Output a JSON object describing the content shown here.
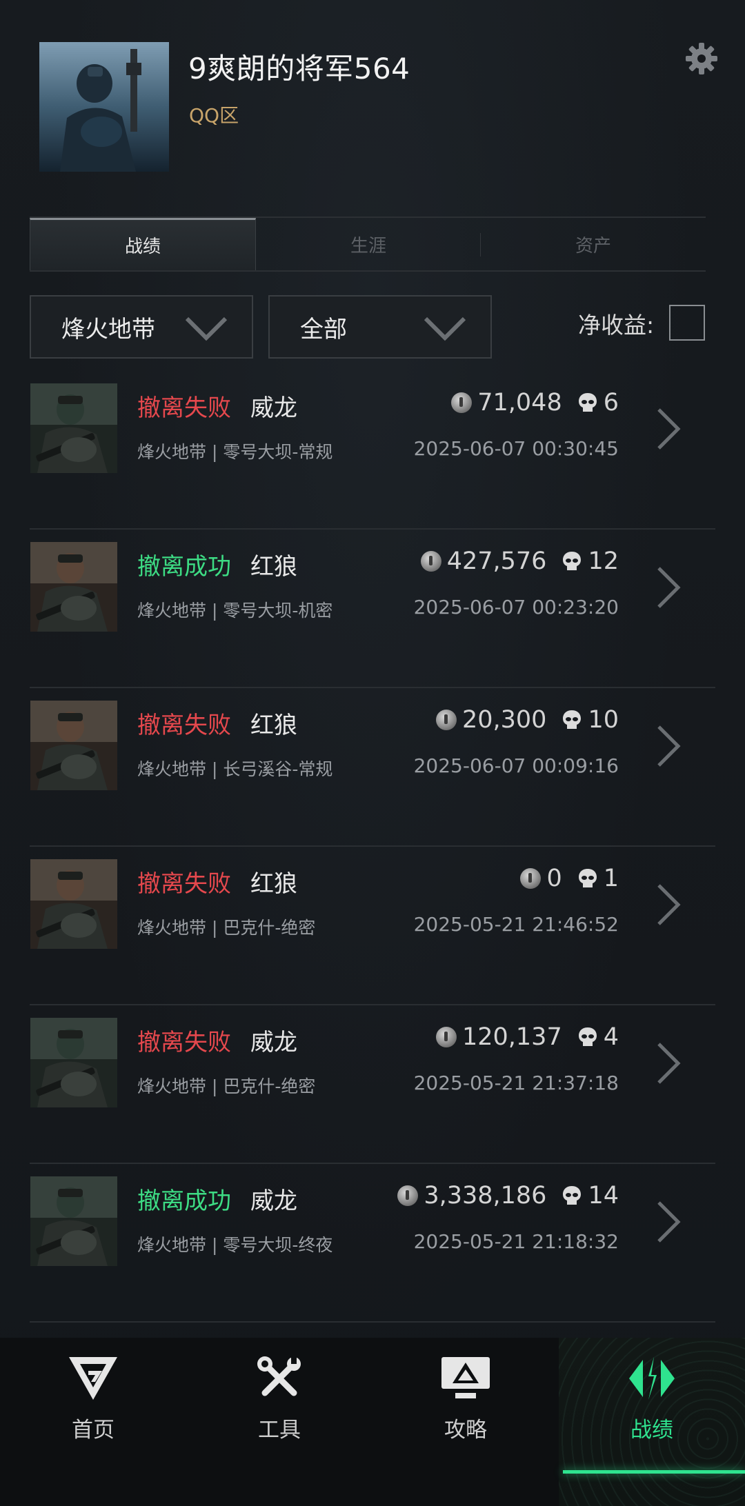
{
  "profile": {
    "username": "9爽朗的将军564",
    "region": "QQ区"
  },
  "tabs": [
    {
      "label": "战绩",
      "active": true
    },
    {
      "label": "生涯",
      "active": false
    },
    {
      "label": "资产",
      "active": false
    }
  ],
  "filters": {
    "mode_label": "烽火地带",
    "scope_label": "全部",
    "net_income_label": "净收益:",
    "net_income_checked": false
  },
  "records": [
    {
      "status": "撤离失败",
      "status_type": "fail",
      "operator": "威龙",
      "mode_map": "烽火地带 | 零号大坝-常规",
      "value": "71,048",
      "kills": "6",
      "time": "2025-06-07 00:30:45"
    },
    {
      "status": "撤离成功",
      "status_type": "success",
      "operator": "红狼",
      "mode_map": "烽火地带 | 零号大坝-机密",
      "value": "427,576",
      "kills": "12",
      "time": "2025-06-07 00:23:20"
    },
    {
      "status": "撤离失败",
      "status_type": "fail",
      "operator": "红狼",
      "mode_map": "烽火地带 | 长弓溪谷-常规",
      "value": "20,300",
      "kills": "10",
      "time": "2025-06-07 00:09:16"
    },
    {
      "status": "撤离失败",
      "status_type": "fail",
      "operator": "红狼",
      "mode_map": "烽火地带 | 巴克什-绝密",
      "value": "0",
      "kills": "1",
      "time": "2025-05-21 21:46:52"
    },
    {
      "status": "撤离失败",
      "status_type": "fail",
      "operator": "威龙",
      "mode_map": "烽火地带 | 巴克什-绝密",
      "value": "120,137",
      "kills": "4",
      "time": "2025-05-21 21:37:18"
    },
    {
      "status": "撤离成功",
      "status_type": "success",
      "operator": "威龙",
      "mode_map": "烽火地带 | 零号大坝-终夜",
      "value": "3,338,186",
      "kills": "14",
      "time": "2025-05-21 21:18:32"
    }
  ],
  "nav": [
    {
      "label": "首页",
      "icon": "home-logo-icon",
      "active": false
    },
    {
      "label": "工具",
      "icon": "tools-icon",
      "active": false
    },
    {
      "label": "攻略",
      "icon": "guide-monitor-icon",
      "active": false
    },
    {
      "label": "战绩",
      "icon": "record-icon",
      "active": true
    }
  ],
  "colors": {
    "fail": "#e5484d",
    "success": "#3ddc84",
    "accent": "#2fe38f",
    "region": "#c8a46a"
  }
}
